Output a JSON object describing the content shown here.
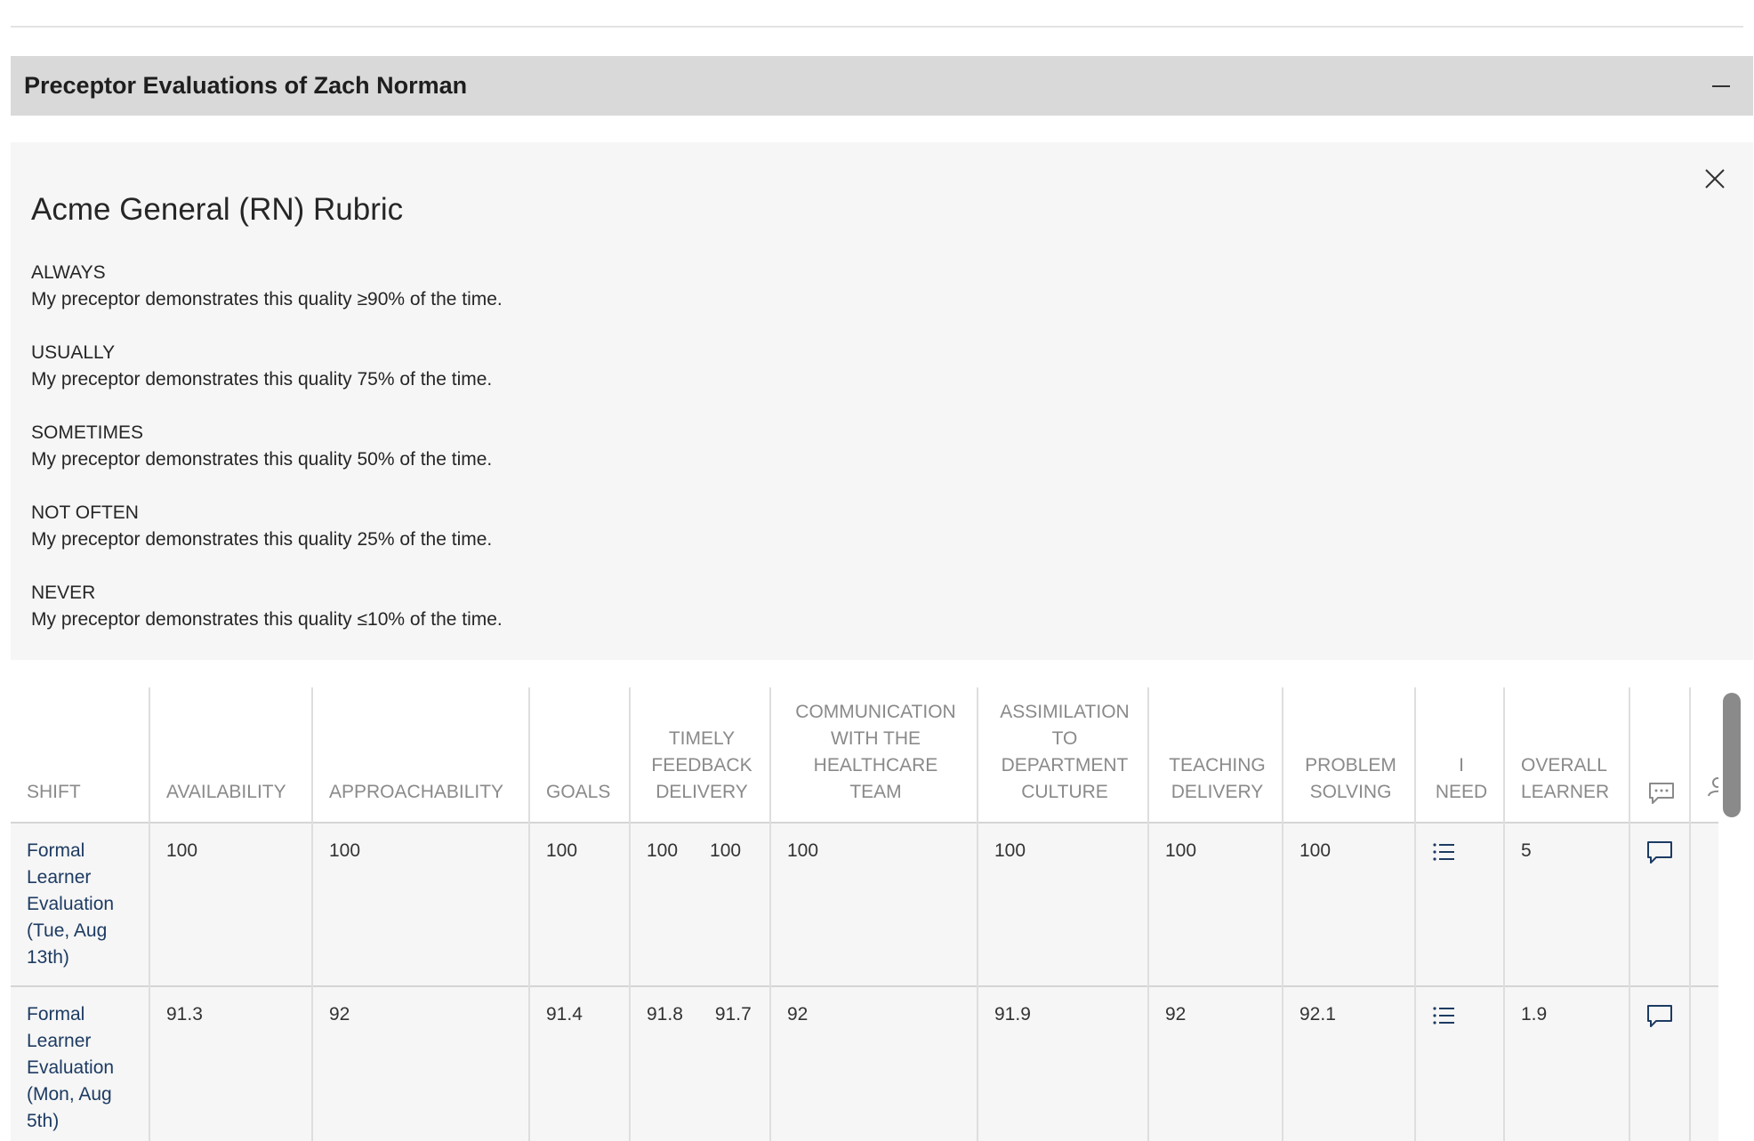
{
  "section": {
    "title": "Preceptor Evaluations of Zach Norman"
  },
  "rubric": {
    "title": "Acme General (RN) Rubric",
    "levels": [
      {
        "name": "ALWAYS",
        "description": "My preceptor demonstrates this quality ≥90% of the time."
      },
      {
        "name": "USUALLY",
        "description": "My preceptor demonstrates this quality 75% of the time."
      },
      {
        "name": "SOMETIMES",
        "description": "My preceptor demonstrates this quality 50% of the time."
      },
      {
        "name": "NOT OFTEN",
        "description": "My preceptor demonstrates this quality 25% of the time."
      },
      {
        "name": "NEVER",
        "description": "My preceptor demonstrates this quality ≤10% of the time."
      }
    ]
  },
  "table": {
    "columns": {
      "shift": "Shift",
      "availability": "Availability",
      "approachability": "Approachability",
      "goals": "Goals",
      "timely_feedback": "Timely Feedback Delivery",
      "communication": "Communication with the Healthcare Team",
      "assimilation": "Assimilation to Department Culture",
      "teaching": "Teaching Delivery",
      "problem_solving": "Problem Solving",
      "i_need": "I Need",
      "overall": "Overall Learner"
    },
    "rows": [
      {
        "shift": "Formal Learner Evaluation (Tue, Aug 13th)",
        "availability": "100",
        "approachability": "100",
        "goals": "100",
        "timely_a": "100",
        "timely_b": "100",
        "communication": "100",
        "assimilation": "100",
        "teaching": "100",
        "problem_solving": "100",
        "overall": "5"
      },
      {
        "shift": "Formal Learner Evaluation (Mon, Aug 5th)",
        "availability": "91.3",
        "approachability": "92",
        "goals": "91.4",
        "timely_a": "91.8",
        "timely_b": "91.7",
        "communication": "92",
        "assimilation": "91.9",
        "teaching": "92",
        "problem_solving": "92.1",
        "overall": "1.9"
      }
    ]
  },
  "icons": {
    "collapse": "minus-icon",
    "close": "close-icon",
    "list": "list-icon",
    "comment": "comment-icon",
    "comments_header": "comments-icon",
    "person_header": "person-icon"
  },
  "colors": {
    "link": "#1d3b62",
    "header_bar": "#d9d9d9",
    "panel": "#f6f6f6",
    "muted_header": "#8a8a8a"
  }
}
